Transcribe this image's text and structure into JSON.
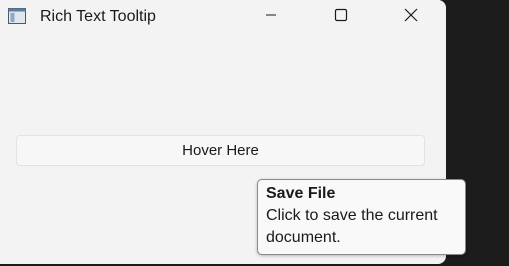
{
  "window": {
    "title": "Rich Text Tooltip",
    "app_icon": "window-icon",
    "controls": {
      "minimize": "minimize-icon",
      "maximize": "maximize-icon",
      "close": "close-icon"
    }
  },
  "main": {
    "button_label": "Hover Here"
  },
  "tooltip": {
    "title": "Save File",
    "body": "Click to save the current document."
  },
  "colors": {
    "window_bg": "#f3f3f3",
    "desktop_bg": "#1c1c1c",
    "tooltip_border": "#8a8a8a"
  }
}
